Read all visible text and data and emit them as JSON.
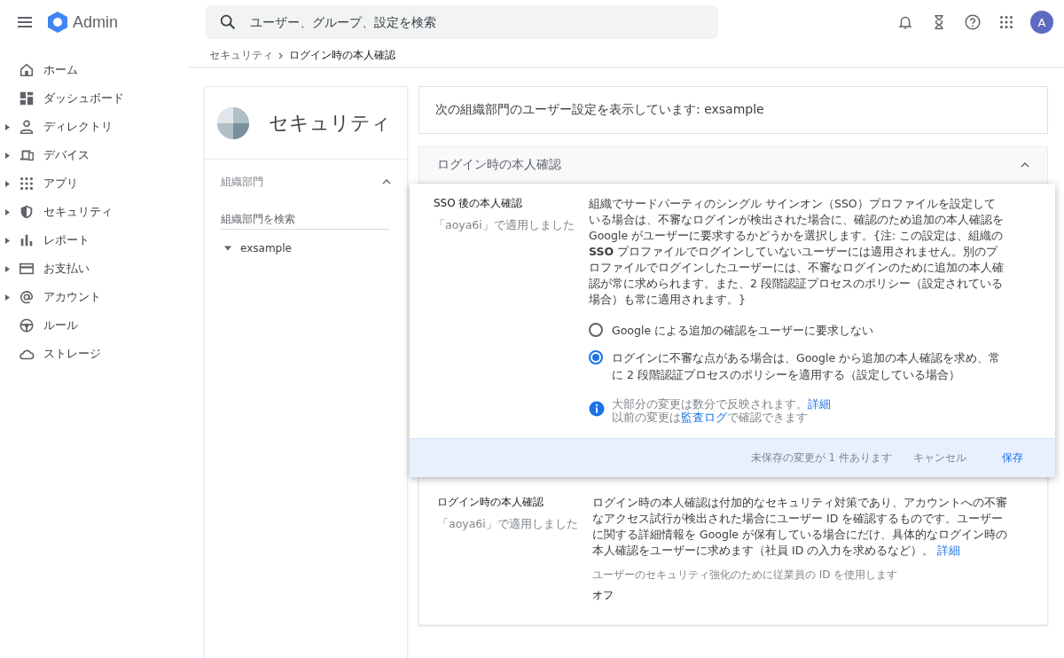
{
  "header": {
    "app_name": "Admin",
    "search": {
      "placeholder": "ユーザー、グループ、設定を検索"
    },
    "avatar": "A"
  },
  "sidebar": {
    "items": [
      {
        "label": "ホーム",
        "expandable": false
      },
      {
        "label": "ダッシュボード",
        "expandable": false
      },
      {
        "label": "ディレクトリ",
        "expandable": true
      },
      {
        "label": "デバイス",
        "expandable": true
      },
      {
        "label": "アプリ",
        "expandable": true
      },
      {
        "label": "セキュリティ",
        "expandable": true
      },
      {
        "label": "レポート",
        "expandable": true
      },
      {
        "label": "お支払い",
        "expandable": true
      },
      {
        "label": "アカウント",
        "expandable": true
      },
      {
        "label": "ルール",
        "expandable": false
      },
      {
        "label": "ストレージ",
        "expandable": false
      }
    ]
  },
  "breadcrumb": [
    "セキュリティ",
    "ログイン時の本人確認"
  ],
  "org_panel": {
    "title": "セキュリティ",
    "section": "組織部門",
    "search": {
      "placeholder": "組織部門を検索"
    },
    "units": [
      {
        "label": "exsample",
        "expanded": true
      }
    ]
  },
  "scope_notice": "次の組織部門のユーザー設定を表示しています: exsample",
  "section": {
    "title": "ログイン時の本人確認",
    "expanded": true
  },
  "settings": [
    {
      "kind": "radio",
      "title": "SSO 後の本人確認",
      "applied": "「aoya6i」で適用しました",
      "description": "組織でサードパーティのシングル サインオン（SSO）プロファイルを設定している場合は、不審なログインが検出された場合に、確認のため追加の本人確認を Google がユーザーに要求するかどうかを選択します。{注: この設定は、組織の **SSO** プロファイルでログインしていないユーザーには適用されません。別のプロファイルでログインしたユーザーには、不審なログインのために追加の本人確認が常に求められます。また、2 段階認証プロセスのポリシー（設定されている場合）も常に適用されます。}",
      "options": [
        {
          "label": "Google による追加の確認をユーザーに要求しない",
          "selected": false
        },
        {
          "label": "ログインに不審な点がある場合は、Google から追加の本人確認を求め、常に 2 段階認証プロセスのポリシーを適用する（設定している場合）",
          "selected": true
        }
      ],
      "info": [
        {
          "before": "大部分の変更は数分で反映されます。",
          "link": "詳細"
        },
        {
          "before": "以前の変更は",
          "link": "監査ログ",
          "after": "で確認できます"
        }
      ],
      "footer": {
        "message": "未保存の変更が 1 件あります",
        "cancel": "キャンセル",
        "save": "保存"
      }
    },
    {
      "kind": "value",
      "title": "ログイン時の本人確認",
      "applied": "「aoya6i」で適用しました",
      "description": "ログイン時の本人確認は付加的なセキュリティ対策であり、アカウントへの不審なアクセス試行が検出された場合にユーザー ID を確認するものです。ユーザーに関する詳細情報を Google が保有している場合にだけ、具体的なログイン時の本人確認をユーザーに求めます（社員 ID の入力を求めるなど）。",
      "link": "詳細",
      "value_label": "ユーザーのセキュリティ強化のために従業員の ID を使用します",
      "value": "オフ"
    }
  ]
}
